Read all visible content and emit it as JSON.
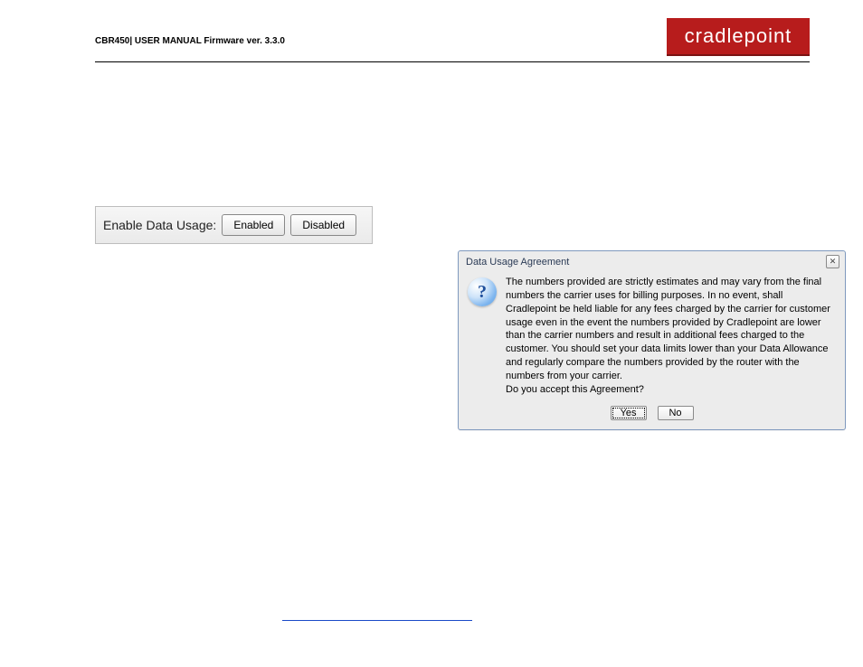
{
  "header": {
    "breadcrumb": "CBR450| USER MANUAL Firmware ver. 3.3.0",
    "brand": "cradlepoint"
  },
  "toggle": {
    "label": "Enable Data Usage:",
    "enabled": "Enabled",
    "disabled": "Disabled"
  },
  "dialog": {
    "title": "Data Usage Agreement",
    "close": "✕",
    "body": "The numbers provided are strictly estimates and may vary from the final numbers the carrier uses for billing purposes. In no event, shall Cradlepoint be held liable for any fees charged by the carrier for customer usage even in the event the numbers provided by Cradlepoint are lower than the carrier numbers and result in additional fees charged to the customer. You should set your data limits lower than your Data Allowance and regularly compare the numbers provided by the router with the numbers from your carrier.",
    "question": "Do you accept this Agreement?",
    "yes": "Yes",
    "no": "No"
  }
}
